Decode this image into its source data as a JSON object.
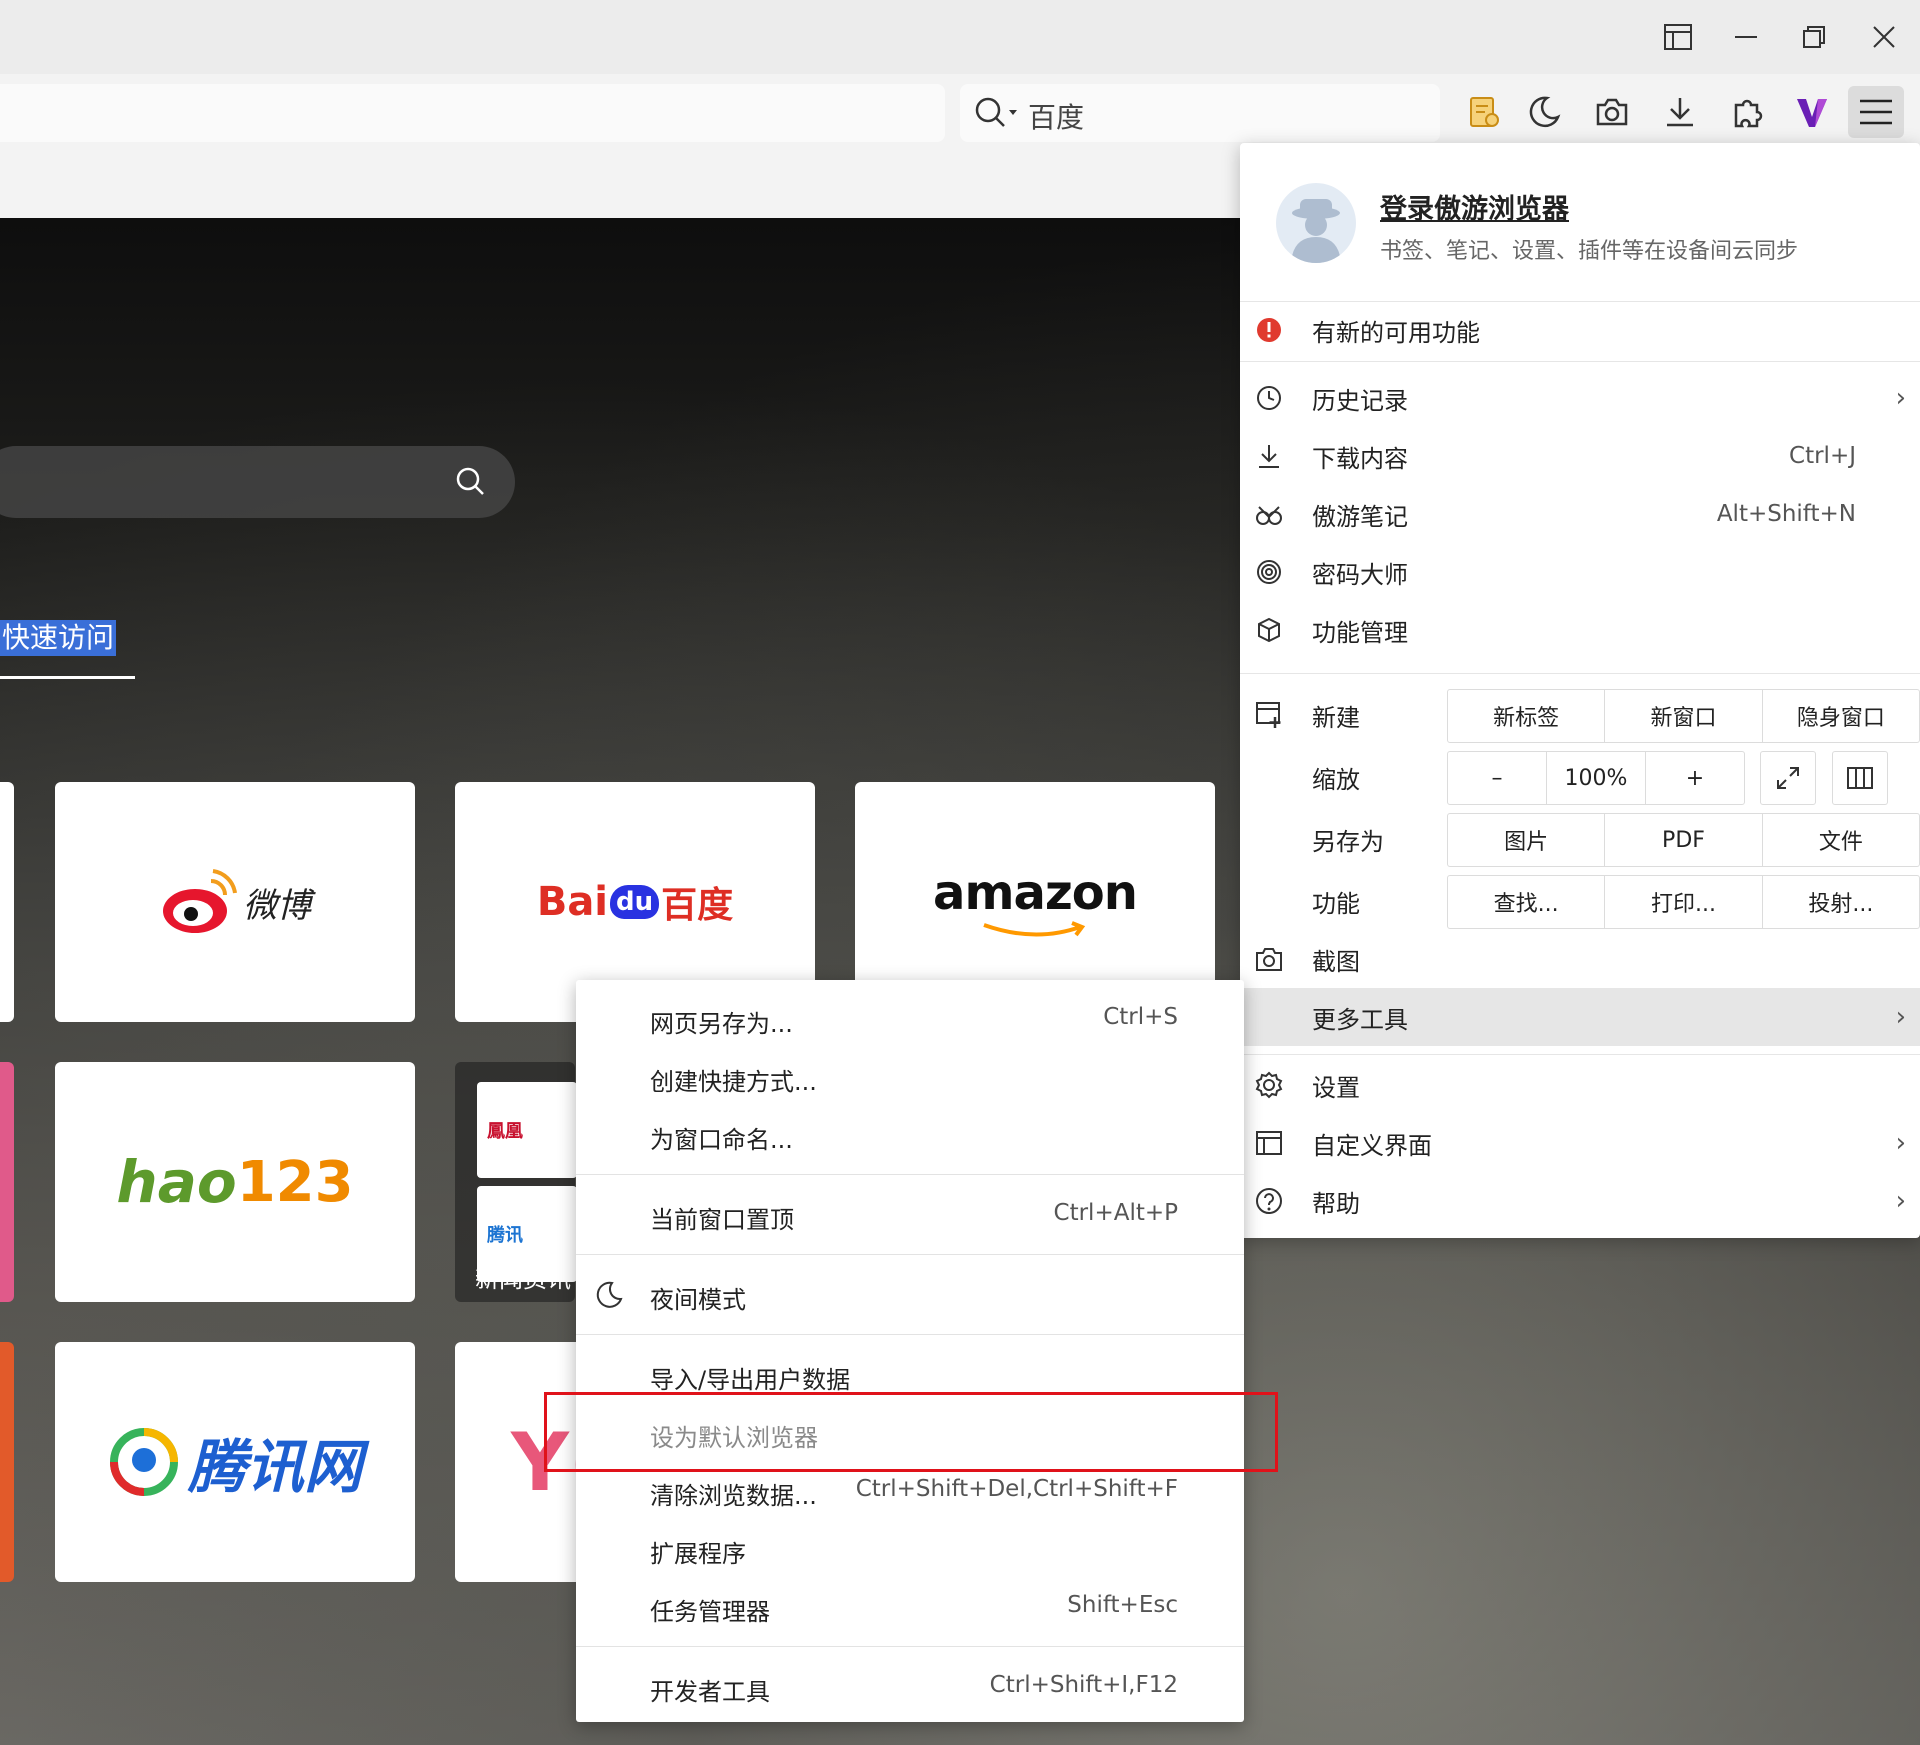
{
  "toolbar": {
    "search_engine": "百度"
  },
  "ntp": {
    "quick_access_label": "快速访问",
    "folder_label": "新闻资讯",
    "folder_items": [
      "鳳凰",
      "腾讯"
    ],
    "tiles": {
      "weibo": "微博",
      "baidu_en": "Bai",
      "baidu_du": "du",
      "baidu_cn": "百度",
      "amazon": "amazon",
      "hao123_h": "hao",
      "hao123_n": "123",
      "tencent": "腾讯网",
      "partial": "Y("
    }
  },
  "menu": {
    "profile_title": "登录傲游浏览器",
    "profile_subtitle": "书签、笔记、设置、插件等在设备间云同步",
    "new_features": "有新的可用功能",
    "history": "历史记录",
    "downloads": "下载内容",
    "downloads_shortcut": "Ctrl+J",
    "notes": "傲游笔记",
    "notes_shortcut": "Alt+Shift+N",
    "passwords": "密码大师",
    "features": "功能管理",
    "new_label": "新建",
    "new_tab": "新标签",
    "new_window": "新窗口",
    "incognito": "隐身窗口",
    "zoom_label": "缩放",
    "zoom_minus": "–",
    "zoom_value": "100%",
    "zoom_plus": "+",
    "save_as_label": "另存为",
    "save_image": "图片",
    "save_pdf": "PDF",
    "save_file": "文件",
    "function_label": "功能",
    "find": "查找...",
    "print": "打印...",
    "cast": "投射...",
    "screenshot": "截图",
    "more_tools": "更多工具",
    "settings": "设置",
    "customize": "自定义界面",
    "help": "帮助"
  },
  "submenu": {
    "save_page": "网页另存为...",
    "save_page_shortcut": "Ctrl+S",
    "create_shortcut": "创建快捷方式...",
    "name_window": "为窗口命名...",
    "pin_window": "当前窗口置顶",
    "pin_window_shortcut": "Ctrl+Alt+P",
    "night_mode": "夜间模式",
    "import_export": "导入/导出用户数据",
    "set_default": "设为默认浏览器",
    "clear_data": "清除浏览数据...",
    "clear_data_shortcut": "Ctrl+Shift+Del,Ctrl+Shift+F",
    "extensions": "扩展程序",
    "task_manager": "任务管理器",
    "task_manager_shortcut": "Shift+Esc",
    "devtools": "开发者工具",
    "devtools_shortcut": "Ctrl+Shift+I,F12"
  },
  "colors": {
    "highlight": "#e0121a",
    "menu_hover": "#e6e6e6",
    "selection": "#3a6fd8",
    "maxthon_purple": "#6a1fb5"
  },
  "icons": [
    "restore-layout-icon",
    "minimize-icon",
    "maximize-icon",
    "close-icon",
    "search-icon",
    "notes-icon",
    "night-mode-icon",
    "camera-icon",
    "download-icon",
    "extensions-icon",
    "maxthon-v-icon",
    "hamburger-menu-icon"
  ]
}
